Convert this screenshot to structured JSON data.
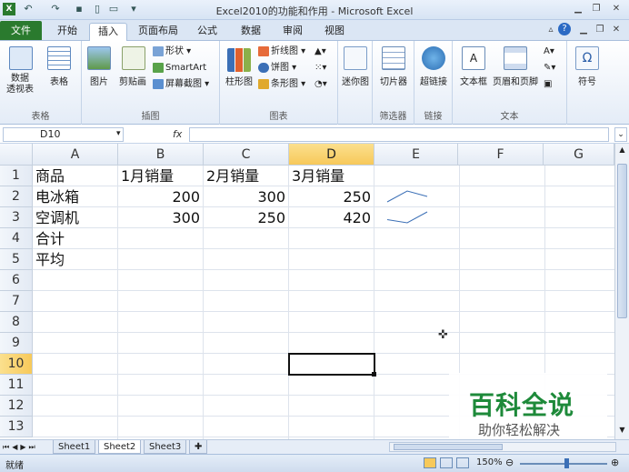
{
  "window": {
    "title": "Excel2010的功能和作用 - Microsoft Excel"
  },
  "tabs": [
    "文件",
    "开始",
    "插入",
    "页面布局",
    "公式",
    "数据",
    "审阅",
    "视图"
  ],
  "active_tab": "插入",
  "ribbon": {
    "tables": {
      "pivot": "数据\n透视表",
      "table": "表格",
      "group": "表格"
    },
    "illustrations": {
      "picture": "图片",
      "clipart": "剪贴画",
      "shapes": "形状",
      "smartart": "SmartArt",
      "screenshot": "屏幕截图",
      "group": "插图"
    },
    "charts": {
      "column": "柱形图",
      "line": "折线图",
      "pie": "饼图",
      "bar": "条形图",
      "group": "图表"
    },
    "sparklines": {
      "label": "迷你图"
    },
    "filter": {
      "slicer": "切片器",
      "group": "筛选器"
    },
    "links": {
      "hyperlink": "超链接",
      "group": "链接"
    },
    "text": {
      "textbox": "文本框",
      "headerfooter": "页眉和页脚",
      "group": "文本"
    },
    "symbols": {
      "symbol": "符号"
    }
  },
  "formula_bar": {
    "name_box": "D10",
    "fx": "fx",
    "value": ""
  },
  "columns": [
    "A",
    "B",
    "C",
    "D",
    "E",
    "F",
    "G"
  ],
  "selected_column": "D",
  "rows": [
    "1",
    "2",
    "3",
    "4",
    "5",
    "6",
    "7",
    "8",
    "9",
    "10",
    "11",
    "12",
    "13"
  ],
  "selected_row": "10",
  "cells": {
    "r1": [
      "商品",
      "1月销量",
      "2月销量",
      "3月销量"
    ],
    "r2": [
      "电冰箱",
      "200",
      "300",
      "250"
    ],
    "r3": [
      "空调机",
      "300",
      "250",
      "420"
    ],
    "r4": [
      "合计"
    ],
    "r5": [
      "平均"
    ]
  },
  "sparkline_data": [
    [
      200,
      300,
      250
    ],
    [
      300,
      250,
      420
    ]
  ],
  "sheets": [
    "Sheet1",
    "Sheet2",
    "Sheet3"
  ],
  "active_sheet": "Sheet2",
  "status": {
    "ready": "就绪",
    "zoom": "150%"
  },
  "watermark": {
    "title": "百科全说",
    "subtitle": "助你轻松解决"
  },
  "colors": {
    "file_tab": "#2a7a2e",
    "selection": "#f7c95a",
    "ribbon": "#e4ecf7"
  }
}
